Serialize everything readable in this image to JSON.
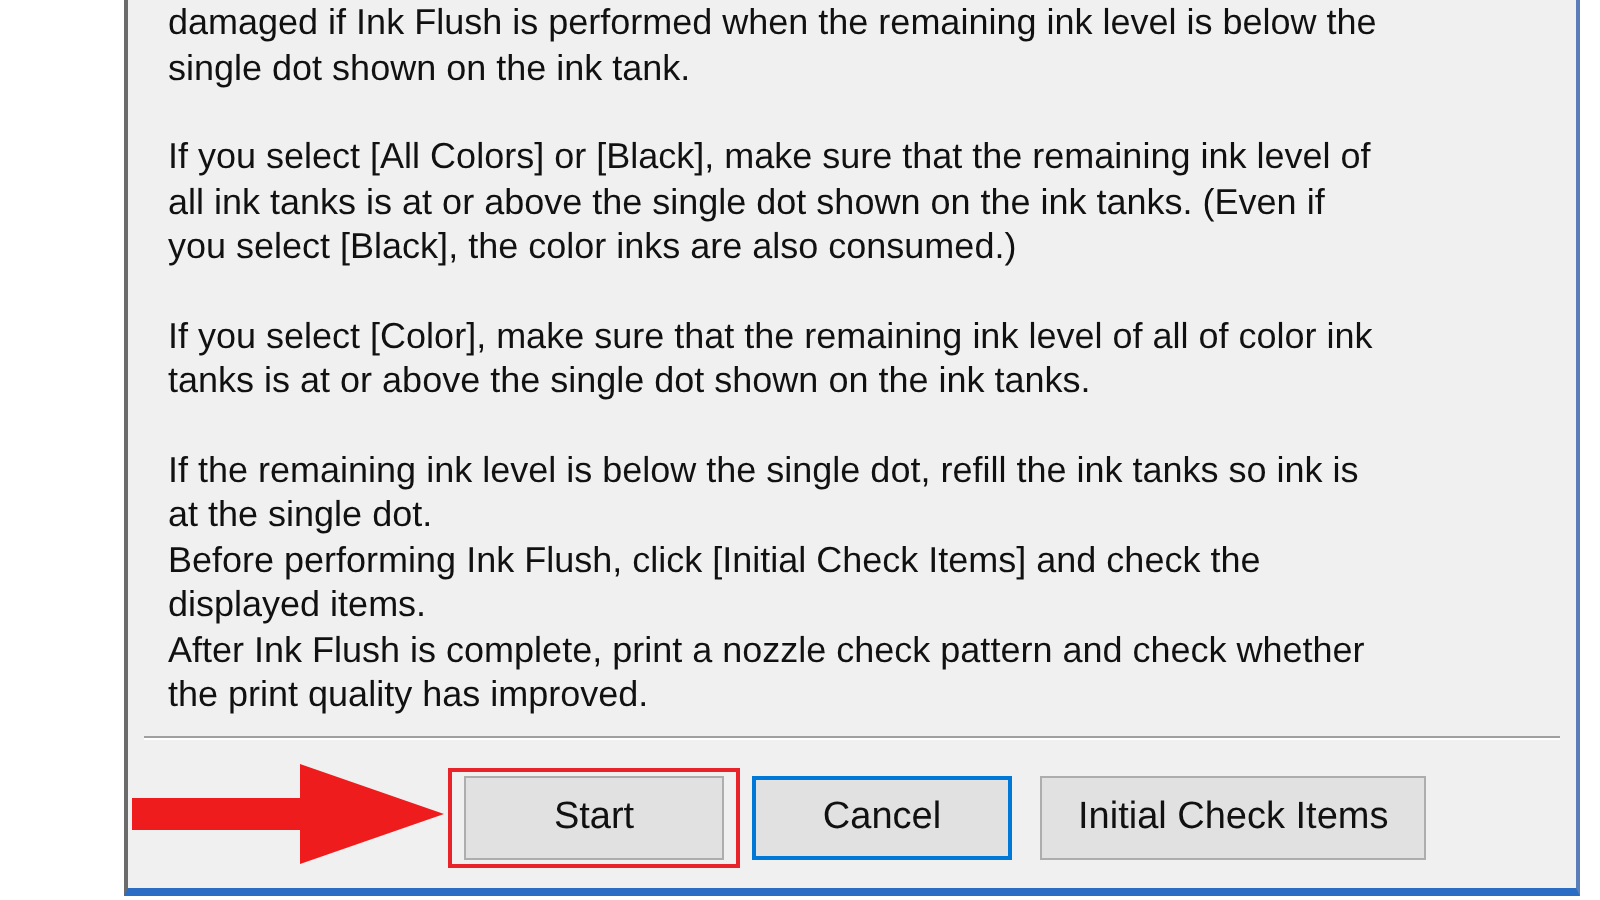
{
  "dialog": {
    "paragraphs": [
      "damaged if Ink Flush is performed when the remaining ink level is below the\nsingle dot shown on the ink tank.",
      "If you select [All Colors] or [Black], make sure that the remaining ink level of\nall ink tanks is at or above the single dot shown on the ink tanks. (Even if\nyou select [Black], the color inks are also consumed.)",
      "If you select [Color], make sure that the remaining ink level of all of color ink\ntanks is at or above the single dot shown on the ink tanks.",
      "If the remaining ink level is below the single dot, refill the ink tanks so ink is\nat the single dot.\nBefore performing Ink Flush, click [Initial Check Items] and check the\ndisplayed items.\nAfter Ink Flush is complete, print a nozzle check pattern and check whether\nthe print quality has improved."
    ],
    "buttons": [
      {
        "label": "Start",
        "focused": false,
        "highlighted": true
      },
      {
        "label": "Cancel",
        "focused": true,
        "highlighted": false
      },
      {
        "label": "Initial Check Items",
        "focused": false,
        "highlighted": false
      }
    ]
  }
}
